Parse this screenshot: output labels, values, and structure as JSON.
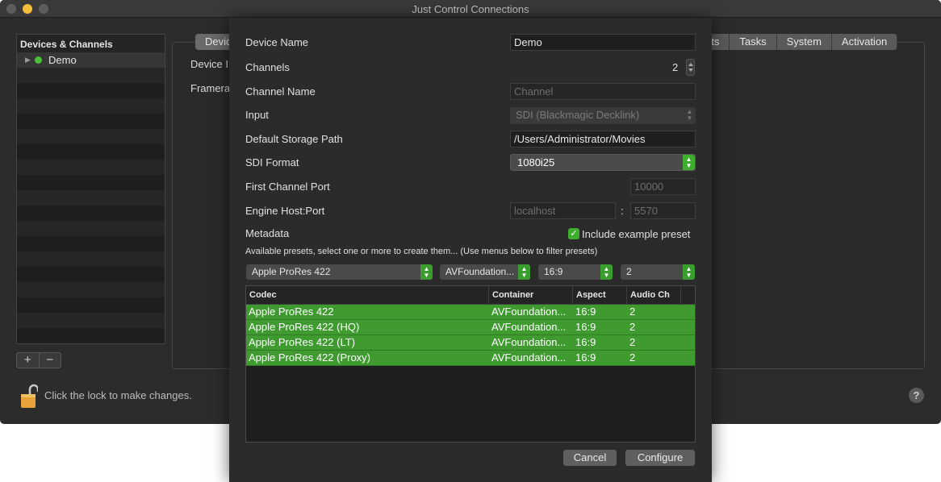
{
  "window": {
    "title": "Just Control Connections"
  },
  "sidebar": {
    "header": "Devices & Channels",
    "device": "Demo"
  },
  "main": {
    "tab_first": "Devic",
    "tabs_right": [
      "ets",
      "Tasks",
      "System",
      "Activation"
    ],
    "label_device": "Device I",
    "label_framerate": "Framera",
    "lock_text": "Click the lock to make changes.",
    "help": "?"
  },
  "sheet": {
    "device_name_label": "Device Name",
    "device_name_value": "Demo",
    "channels_label": "Channels",
    "channels_value": "2",
    "channel_name_label": "Channel Name",
    "channel_name_placeholder": "Channel",
    "input_label": "Input",
    "input_value": "SDI (Blackmagic Decklink)",
    "storage_label": "Default Storage Path",
    "storage_value": "/Users/Administrator/Movies",
    "sdi_label": "SDI Format",
    "sdi_value": "1080i25",
    "first_port_label": "First Channel Port",
    "first_port_value": "10000",
    "engine_label": "Engine Host:Port",
    "engine_host": "localhost",
    "engine_sep": ":",
    "engine_port": "5570",
    "metadata_label": "Metadata",
    "include_example": "Include example preset",
    "presets_text": "Available presets, select one or more to create them... (Use menus below to filter presets)",
    "filters": {
      "codec": "Apple ProRes 422",
      "container": "AVFoundation...",
      "aspect": "16:9",
      "audio": "2"
    },
    "table": {
      "headers": [
        "Codec",
        "Container",
        "Aspect",
        "Audio Ch"
      ],
      "rows": [
        [
          "Apple ProRes 422",
          "AVFoundation...",
          "16:9",
          "2"
        ],
        [
          "Apple ProRes 422 (HQ)",
          "AVFoundation...",
          "16:9",
          "2"
        ],
        [
          "Apple ProRes 422 (LT)",
          "AVFoundation...",
          "16:9",
          "2"
        ],
        [
          "Apple ProRes 422 (Proxy)",
          "AVFoundation...",
          "16:9",
          "2"
        ]
      ]
    },
    "cancel": "Cancel",
    "configure": "Configure"
  }
}
